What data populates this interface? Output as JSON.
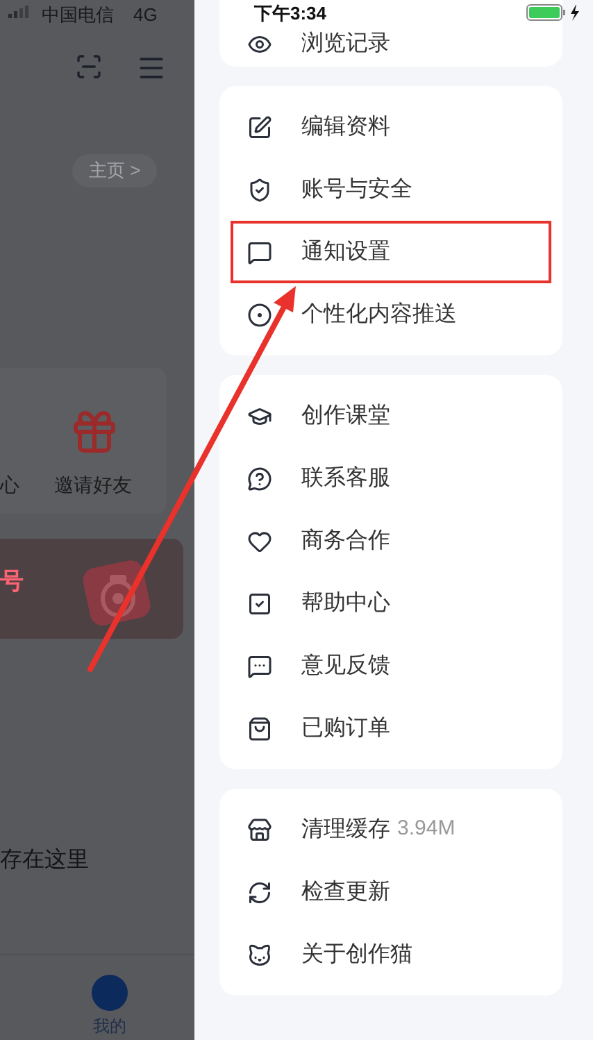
{
  "status_bar": {
    "carrier": "中国电信",
    "network": "4G",
    "time": "下午3:34"
  },
  "background_page": {
    "home_link": "主页 >",
    "shortcuts": [
      {
        "label": "心"
      },
      {
        "label": "邀请好友"
      }
    ],
    "banner": {
      "title": "号"
    },
    "hint": "存在这里",
    "nav": [
      {
        "label": "我的",
        "selected": true
      }
    ]
  },
  "drawer": {
    "groups": [
      {
        "items": [
          {
            "kind": "eye",
            "label": "浏览记录",
            "highlighted": false
          }
        ]
      },
      {
        "items": [
          {
            "kind": "edit",
            "label": "编辑资料",
            "highlighted": false
          },
          {
            "kind": "shield",
            "label": "账号与安全",
            "highlighted": false
          },
          {
            "kind": "notify",
            "label": "通知设置",
            "highlighted": true
          },
          {
            "kind": "target",
            "label": "个性化内容推送",
            "highlighted": false
          }
        ]
      },
      {
        "items": [
          {
            "kind": "course",
            "label": "创作课堂",
            "highlighted": false
          },
          {
            "kind": "question",
            "label": "联系客服",
            "highlighted": false
          },
          {
            "kind": "heart",
            "label": "商务合作",
            "highlighted": false
          },
          {
            "kind": "help",
            "label": "帮助中心",
            "highlighted": false
          },
          {
            "kind": "feedback",
            "label": "意见反馈",
            "highlighted": false
          },
          {
            "kind": "bag",
            "label": "已购订单",
            "highlighted": false
          }
        ]
      },
      {
        "items": [
          {
            "kind": "cache",
            "label": "清理缓存",
            "detail": "3.94M",
            "highlighted": false
          },
          {
            "kind": "refresh",
            "label": "检查更新",
            "highlighted": false
          },
          {
            "kind": "cat",
            "label": "关于创作猫",
            "highlighted": false
          }
        ]
      }
    ]
  }
}
